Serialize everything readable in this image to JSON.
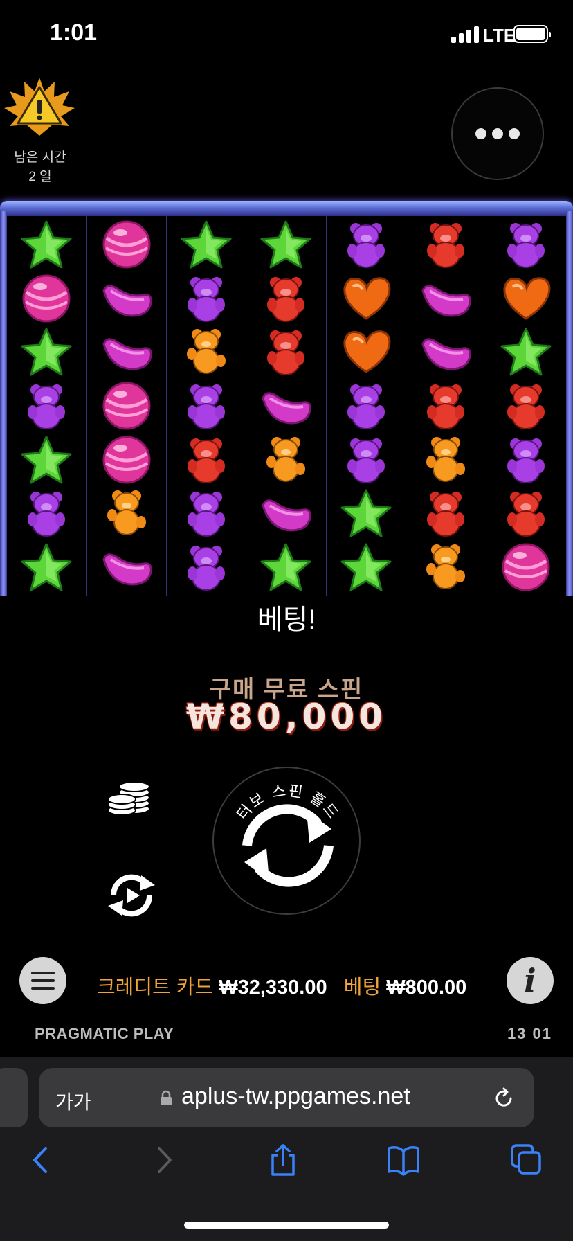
{
  "status_bar": {
    "time": "1:01",
    "network": "LTE"
  },
  "timer": {
    "label": "남은 시간",
    "value": "2 일"
  },
  "reels": [
    [
      "star-green",
      "candy-pink",
      "star-green",
      "bear-purple",
      "star-green",
      "bear-purple",
      "star-green"
    ],
    [
      "candy-pink",
      "jelly-magenta",
      "jelly-magenta",
      "candy-pink",
      "candy-pink",
      "bear-orange",
      "jelly-magenta"
    ],
    [
      "star-green",
      "bear-purple",
      "bear-orange",
      "bear-purple",
      "bear-red",
      "bear-purple",
      "bear-purple"
    ],
    [
      "star-green",
      "bear-red",
      "bear-red",
      "jelly-magenta",
      "bear-orange",
      "jelly-magenta",
      "star-green"
    ],
    [
      "bear-purple",
      "heart-orange",
      "heart-orange",
      "bear-purple",
      "bear-purple",
      "star-green",
      "star-green"
    ],
    [
      "bear-red",
      "jelly-magenta",
      "jelly-magenta",
      "bear-red",
      "bear-orange",
      "bear-red",
      "bear-orange"
    ],
    [
      "bear-purple",
      "heart-orange",
      "star-green",
      "bear-red",
      "bear-purple",
      "bear-red",
      "candy-pink"
    ]
  ],
  "bet_message": "베팅!",
  "buy_feature": {
    "title": "구매 무료 스핀",
    "amount": "₩80,000"
  },
  "spin_button": {
    "label": "터보 스핀 홀드"
  },
  "bar": {
    "credit_label": "크레디트 카드",
    "credit_value": "₩32,330.00",
    "bet_label": "베팅",
    "bet_value": "₩800.00"
  },
  "footer": {
    "brand": "PRAGMATIC PLAY",
    "clock": "13 01"
  },
  "browser": {
    "aa": "가가",
    "url": "aplus-tw.ppgames.net"
  },
  "colors": {
    "accent": "#f0a33a",
    "frame": "#5c6fd8"
  }
}
